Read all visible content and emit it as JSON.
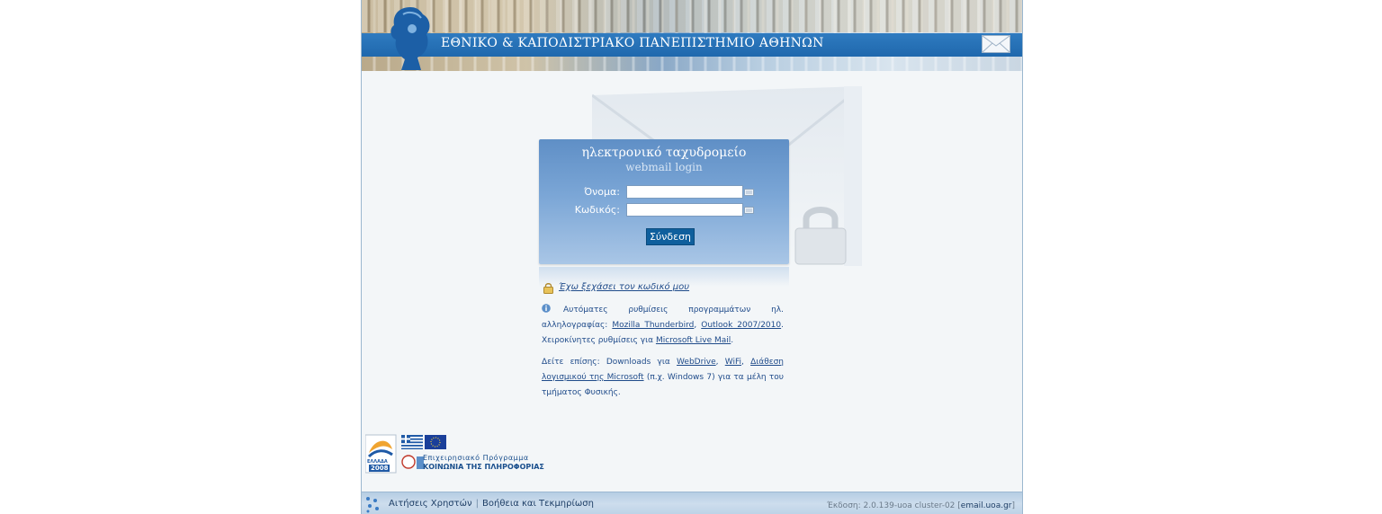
{
  "header": {
    "title": "ΕΘΝΙΚΟ & ΚΑΠΟΔΙΣΤΡΙΑΚΟ ΠΑΝΕΠΙΣΤΗΜΙΟ ΑΘΗΝΩΝ",
    "logo_icon": "athena-logo-icon",
    "mail_icon": "envelope-icon"
  },
  "login": {
    "title": "ηλεκτρονικό ταχυδρομείο",
    "subtitle": "webmail login",
    "username_label": "Όνομα:",
    "username_value": "",
    "password_label": "Κωδικός:",
    "password_value": "",
    "keyboard_icon": "keyboard-icon",
    "submit_label": "Σύνδεση"
  },
  "info": {
    "forgot_password": "Έχω ξεχάσει τον κωδικό μου",
    "auto_settings_text": "Αυτόματες ρυθμίσεις προγραμμάτων ηλ. αλληλογραφίας:",
    "thunderbird_link": "Mozilla Thunderbird",
    "outlook_link": "Outlook 2007/2010",
    "manual_settings_text": "Χειροκίνητες ρυθμίσεις για",
    "livemail_link": "Microsoft Live Mail",
    "see_also_text": "Δείτε επίσης: Downloads για",
    "webdrive_link": "WebDrive",
    "wifi_link": "WiFi",
    "ms_software_link": "Διάθεση λογισμικού της Microsoft",
    "ms_software_suffix": "(π.χ. Windows 7) για τα μέλη του τμήματος Φυσικής."
  },
  "program": {
    "line1": "Επιχειρησιακό Πρόγραμμα",
    "line2": "ΚΟΙΝΩΝΙΑ ΤΗΣ ΠΛΗΡΟΦΟΡΙΑΣ",
    "badge_text": "ΕΛΛΑΔΑ",
    "year": "2008"
  },
  "footer": {
    "user_requests": "Αιτήσεις Χρηστών",
    "help": "Βοήθεια και Τεκμηρίωση",
    "version_text": "Έκδοση: 2.0.139-uoa cluster-02",
    "site_link": "email.uoa.gr"
  },
  "colors": {
    "header_band": "#1f68ad",
    "login_button": "#0f5f9d",
    "link": "#1f4b8a"
  }
}
